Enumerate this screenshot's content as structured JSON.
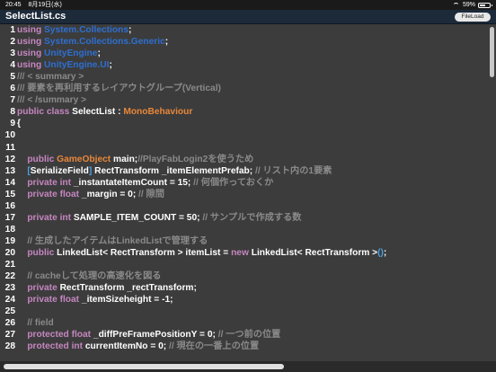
{
  "status": {
    "time": "20:45",
    "date": "8月19日(水)",
    "battery": "59%",
    "battery_level": 0.59
  },
  "header": {
    "title": "SelectList.cs",
    "button": "FileLoad"
  },
  "lines": [
    {
      "n": "1",
      "tokens": [
        [
          "kw",
          "using "
        ],
        [
          "ns",
          "System.Collections"
        ],
        [
          "pl",
          ";"
        ]
      ]
    },
    {
      "n": "2",
      "tokens": [
        [
          "kw",
          "using "
        ],
        [
          "ns",
          "System.Collections.Generic"
        ],
        [
          "pl",
          ";"
        ]
      ]
    },
    {
      "n": "3",
      "tokens": [
        [
          "kw",
          "using "
        ],
        [
          "ns",
          "UnityEngine"
        ],
        [
          "pl",
          ";"
        ]
      ]
    },
    {
      "n": "4",
      "tokens": [
        [
          "kw",
          "using "
        ],
        [
          "ns",
          "UnityEngine.UI"
        ],
        [
          "pl",
          ";"
        ]
      ]
    },
    {
      "n": "5",
      "tokens": [
        [
          "cm",
          "/// < summary >"
        ]
      ]
    },
    {
      "n": "6",
      "tokens": [
        [
          "cm",
          "/// 要素を再利用するレイアウトグループ(Vertical)"
        ]
      ]
    },
    {
      "n": "7",
      "tokens": [
        [
          "cm",
          "/// < /summary >"
        ]
      ]
    },
    {
      "n": "8",
      "tokens": [
        [
          "kw",
          "public class "
        ],
        [
          "pl",
          "SelectList : "
        ],
        [
          "ty",
          "MonoBehaviour"
        ]
      ]
    },
    {
      "n": "9",
      "tokens": [
        [
          "pl",
          "{"
        ]
      ]
    },
    {
      "n": "10",
      "tokens": []
    },
    {
      "n": "11",
      "tokens": []
    },
    {
      "n": "12",
      "tokens": [
        [
          "pl",
          "    "
        ],
        [
          "kw",
          "public "
        ],
        [
          "ty",
          "GameObject"
        ],
        [
          "pl",
          " main;"
        ],
        [
          "cm",
          "//PlayFabLogin2を使うため"
        ]
      ]
    },
    {
      "n": "13",
      "tokens": [
        [
          "pl",
          "    "
        ],
        [
          "br",
          "["
        ],
        [
          "pl",
          "SerializeField"
        ],
        [
          "br",
          "]"
        ],
        [
          "pl",
          " RectTransform _itemElementPrefab; "
        ],
        [
          "cm",
          "// リスト内の1要素"
        ]
      ]
    },
    {
      "n": "14",
      "tokens": [
        [
          "pl",
          "    "
        ],
        [
          "kw",
          "private int "
        ],
        [
          "pl",
          "_instantateItemCount = 15; "
        ],
        [
          "cm",
          "// 何個作っておくか"
        ]
      ]
    },
    {
      "n": "15",
      "tokens": [
        [
          "pl",
          "    "
        ],
        [
          "kw",
          "private float "
        ],
        [
          "pl",
          "_margin = 0; "
        ],
        [
          "cm",
          "// 隙間"
        ]
      ]
    },
    {
      "n": "16",
      "tokens": []
    },
    {
      "n": "17",
      "tokens": [
        [
          "pl",
          "    "
        ],
        [
          "kw",
          "private int "
        ],
        [
          "pl",
          "SAMPLE_ITEM_COUNT = 50; "
        ],
        [
          "cm",
          "// サンプルで作成する数"
        ]
      ]
    },
    {
      "n": "18",
      "tokens": []
    },
    {
      "n": "19",
      "tokens": [
        [
          "pl",
          "    "
        ],
        [
          "cm",
          "// 生成したアイテムはLinkedListで管理する"
        ]
      ]
    },
    {
      "n": "20",
      "tokens": [
        [
          "pl",
          "    "
        ],
        [
          "kw",
          "public "
        ],
        [
          "pl",
          "LinkedList< RectTransform > itemList = "
        ],
        [
          "kw",
          "new "
        ],
        [
          "pl",
          "LinkedList< RectTransform >"
        ],
        [
          "br",
          "()"
        ],
        [
          "pl",
          ";"
        ]
      ]
    },
    {
      "n": "21",
      "tokens": []
    },
    {
      "n": "22",
      "tokens": [
        [
          "pl",
          "    "
        ],
        [
          "cm",
          "// cacheして処理の高速化を図る"
        ]
      ]
    },
    {
      "n": "23",
      "tokens": [
        [
          "pl",
          "    "
        ],
        [
          "kw",
          "private "
        ],
        [
          "pl",
          "RectTransform _rectTransform;"
        ]
      ]
    },
    {
      "n": "24",
      "tokens": [
        [
          "pl",
          "    "
        ],
        [
          "kw",
          "private float "
        ],
        [
          "pl",
          "_itemSizeheight = -1;"
        ]
      ]
    },
    {
      "n": "25",
      "tokens": []
    },
    {
      "n": "26",
      "tokens": [
        [
          "pl",
          "    "
        ],
        [
          "cm",
          "// field"
        ]
      ]
    },
    {
      "n": "27",
      "tokens": [
        [
          "pl",
          "    "
        ],
        [
          "kw",
          "protected float "
        ],
        [
          "pl",
          "_diffPreFramePositionY = 0; "
        ],
        [
          "cm",
          "// 一つ前の位置"
        ]
      ]
    },
    {
      "n": "28",
      "tokens": [
        [
          "pl",
          "    "
        ],
        [
          "kw",
          "protected int "
        ],
        [
          "pl",
          "currentItemNo = 0; "
        ],
        [
          "cm",
          "// 現在の一番上の位置"
        ]
      ]
    }
  ]
}
